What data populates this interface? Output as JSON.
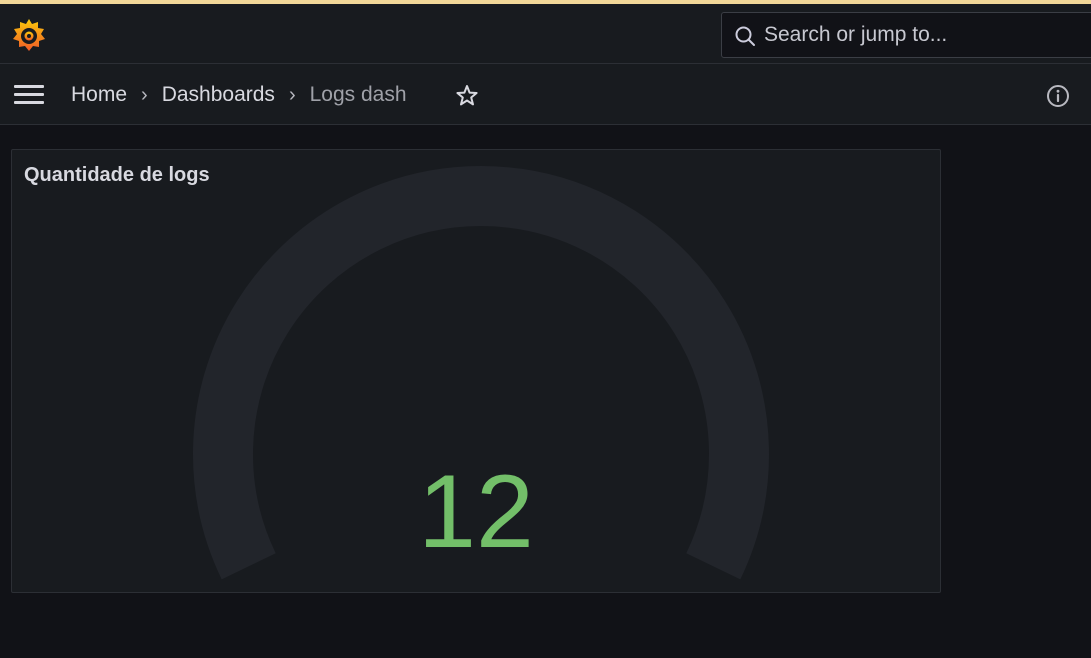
{
  "app": {
    "accent_color": "#f2d798",
    "logo_icon": "grafana-logo-icon"
  },
  "search": {
    "placeholder": "Search or jump to...",
    "icon": "search-icon"
  },
  "breadcrumbs": {
    "home": "Home",
    "dashboards": "Dashboards",
    "current": "Logs dash",
    "separator": "›"
  },
  "toolbar": {
    "menu_icon": "hamburger-menu-icon",
    "star_icon": "star-icon",
    "info_icon": "info-icon"
  },
  "panel": {
    "title": "Quantidade de logs",
    "value": "12",
    "value_color": "#73bf69",
    "track_color": "#22252b"
  }
}
